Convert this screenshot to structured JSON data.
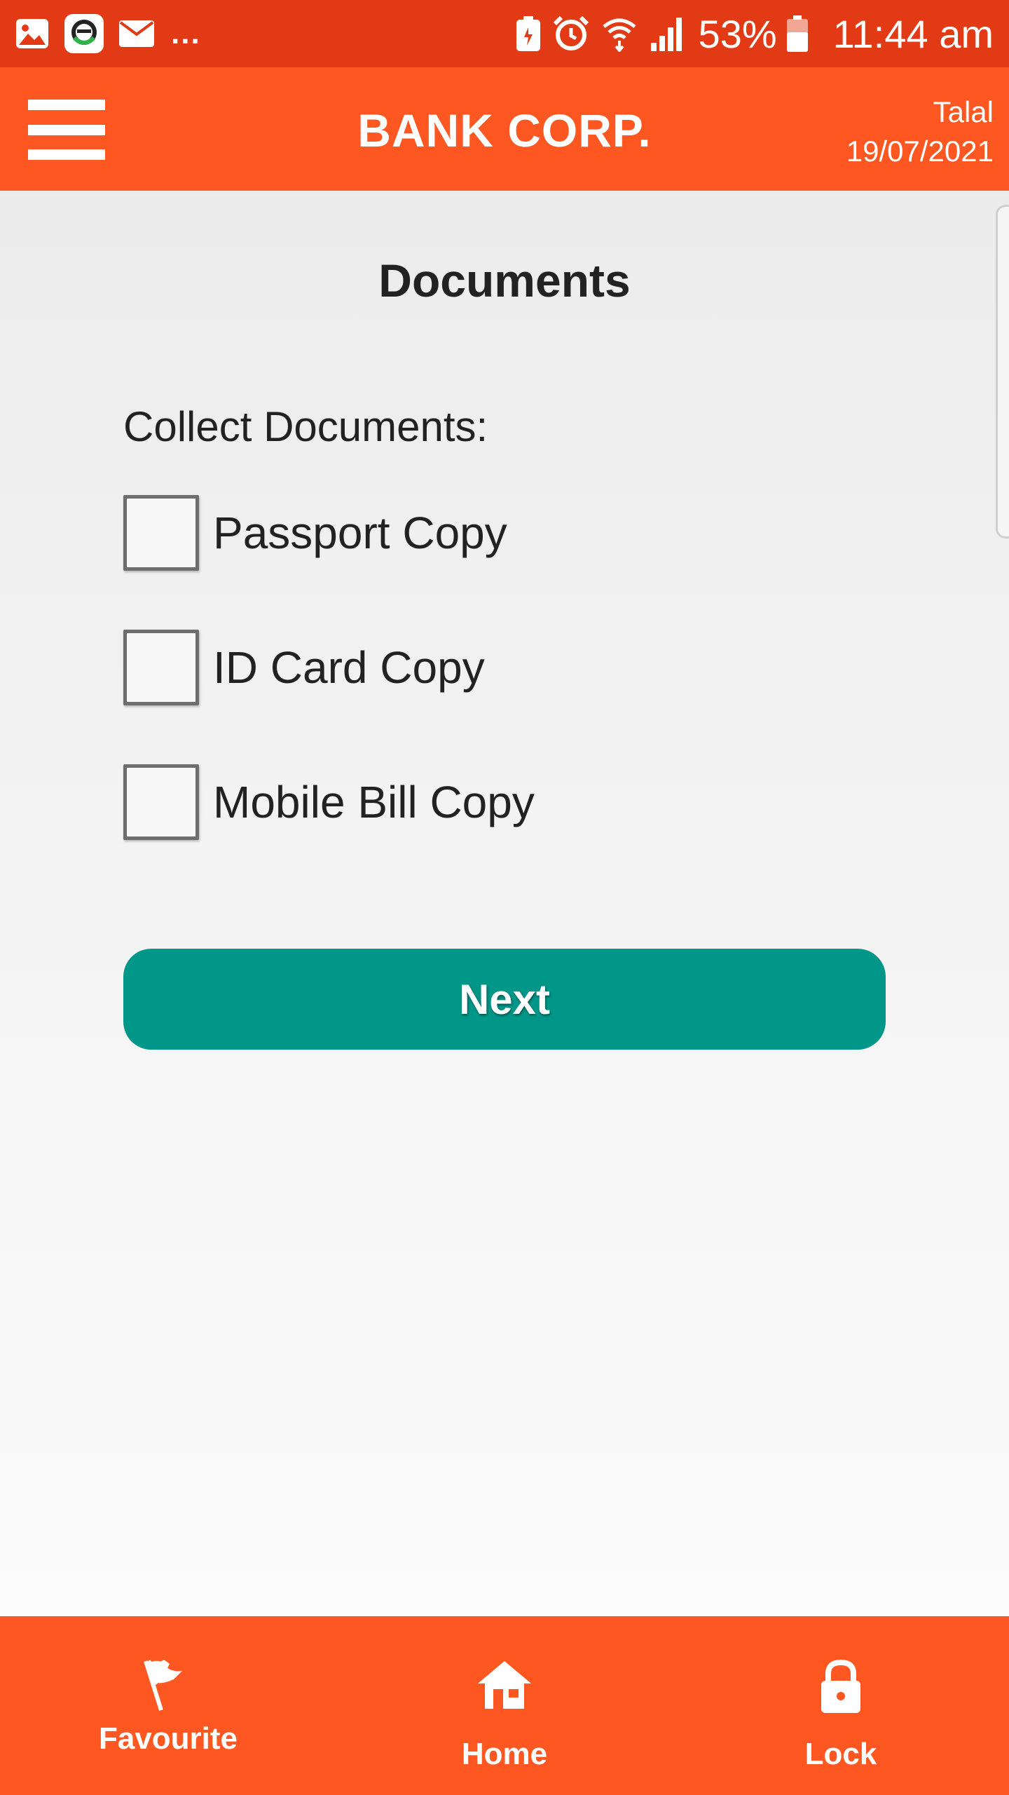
{
  "status_bar": {
    "left_icons": [
      "gallery-icon",
      "app-icon",
      "mail-icon"
    ],
    "overflow": "...",
    "right_icons": [
      "battery-saver-icon",
      "alarm-icon",
      "wifi-icon",
      "signal-icon",
      "battery-icon"
    ],
    "battery": "53%",
    "time": "11:44 am"
  },
  "app_bar": {
    "title": "BANK CORP.",
    "user": "Talal",
    "date": "19/07/2021",
    "menu_icon": "hamburger-menu-icon"
  },
  "page": {
    "title": "Documents",
    "section_label": "Collect Documents:",
    "documents": [
      {
        "label": "Passport Copy",
        "checked": false
      },
      {
        "label": "ID Card Copy",
        "checked": false
      },
      {
        "label": "Mobile Bill Copy",
        "checked": false
      }
    ],
    "next_label": "Next"
  },
  "bottom_nav": {
    "items": [
      {
        "label": "Favourite",
        "icon": "flag-icon"
      },
      {
        "label": "Home",
        "icon": "home-icon"
      },
      {
        "label": "Lock",
        "icon": "lock-icon"
      }
    ]
  },
  "colors": {
    "status_bar": "#e23a14",
    "primary": "#ff5722",
    "button": "#009688",
    "text": "#222222"
  }
}
